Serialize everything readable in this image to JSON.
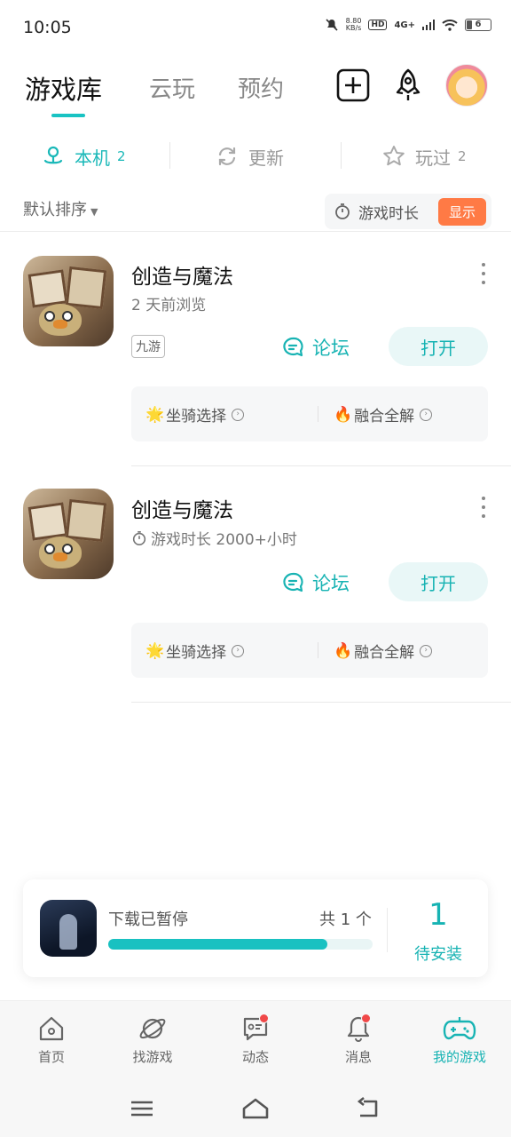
{
  "status_bar": {
    "time": "10:05",
    "net_speed_value": "8.80",
    "net_speed_unit": "KB/s",
    "hd": "HD",
    "signal": "4G+",
    "battery": "6"
  },
  "top_tabs": [
    {
      "label": "游戏库",
      "active": true
    },
    {
      "label": "云玩",
      "active": false
    },
    {
      "label": "预约",
      "active": false
    }
  ],
  "sub_tabs": [
    {
      "label": "本机",
      "count": "2",
      "icon": "local-device-icon",
      "active": true
    },
    {
      "label": "更新",
      "count": "",
      "icon": "refresh-icon",
      "active": false
    },
    {
      "label": "玩过",
      "count": "2",
      "icon": "star-icon",
      "active": false
    }
  ],
  "sort": {
    "label": "默认排序",
    "playtime_label": "游戏时长",
    "show_button": "显示"
  },
  "games": [
    {
      "title": "创造与魔法",
      "subtitle": "2 天前浏览",
      "tag": "九游",
      "forum_label": "论坛",
      "open_label": "打开",
      "links": [
        {
          "emoji": "🌟",
          "label": "坐骑选择"
        },
        {
          "emoji": "🔥",
          "label": "融合全解"
        }
      ]
    },
    {
      "title": "创造与魔法",
      "subtitle": "游戏时长 2000+小时",
      "forum_label": "论坛",
      "open_label": "打开",
      "links": [
        {
          "emoji": "🌟",
          "label": "坐骑选择"
        },
        {
          "emoji": "🔥",
          "label": "融合全解"
        }
      ]
    }
  ],
  "download": {
    "status": "下载已暂停",
    "total": "共 1 个",
    "progress_fraction": 0.83,
    "pending_count": "1",
    "pending_label": "待安装"
  },
  "bottom_nav": [
    {
      "label": "首页",
      "icon": "home-icon",
      "badge": false,
      "active": false
    },
    {
      "label": "找游戏",
      "icon": "planet-icon",
      "badge": false,
      "active": false
    },
    {
      "label": "动态",
      "icon": "feed-icon",
      "badge": true,
      "active": false
    },
    {
      "label": "消息",
      "icon": "bell-icon",
      "badge": true,
      "active": false
    },
    {
      "label": "我的游戏",
      "icon": "gamepad-icon",
      "badge": false,
      "active": true
    }
  ],
  "colors": {
    "accent": "#17b3b3",
    "badge": "#f04848",
    "show_button": "#ff7a45"
  }
}
